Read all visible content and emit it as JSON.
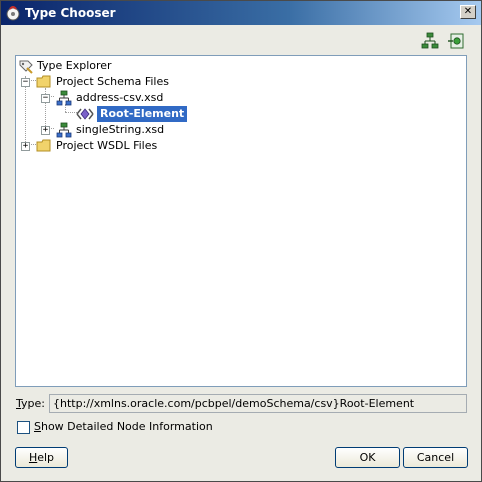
{
  "window": {
    "title": "Type Chooser",
    "close_glyph": "✕"
  },
  "toolbar": {
    "icons": [
      "schema-tree-icon",
      "import-schema-icon"
    ]
  },
  "tree": {
    "root": {
      "label": "Type Explorer",
      "icon": "type-explorer-icon"
    },
    "project_schema_files": {
      "label": "Project Schema Files",
      "expanded": true,
      "icon": "folder-icon"
    },
    "address_csv": {
      "label": "address-csv.xsd",
      "expanded": true,
      "icon": "schema-icon"
    },
    "root_element": {
      "label": "Root-Element",
      "selected": true,
      "icon": "element-icon"
    },
    "single_string": {
      "label": "singleString.xsd",
      "expanded": false,
      "icon": "schema-icon"
    },
    "project_wsdl_files": {
      "label": "Project WSDL Files",
      "expanded": false,
      "icon": "folder-icon"
    }
  },
  "type_field": {
    "label_mnemonic": "T",
    "label_rest": "ype:",
    "value": "{http://xmlns.oracle.com/pcbpel/demoSchema/csv}Root-Element"
  },
  "show_detailed": {
    "mnemonic": "S",
    "rest": "how Detailed Node Information",
    "checked": false
  },
  "buttons": {
    "help_mnemonic": "H",
    "help_rest": "elp",
    "ok": "OK",
    "cancel": "Cancel"
  },
  "colors": {
    "title_gradient_start": "#0a246a",
    "selection": "#316ac5",
    "dialog_bg": "#ebebe4"
  }
}
